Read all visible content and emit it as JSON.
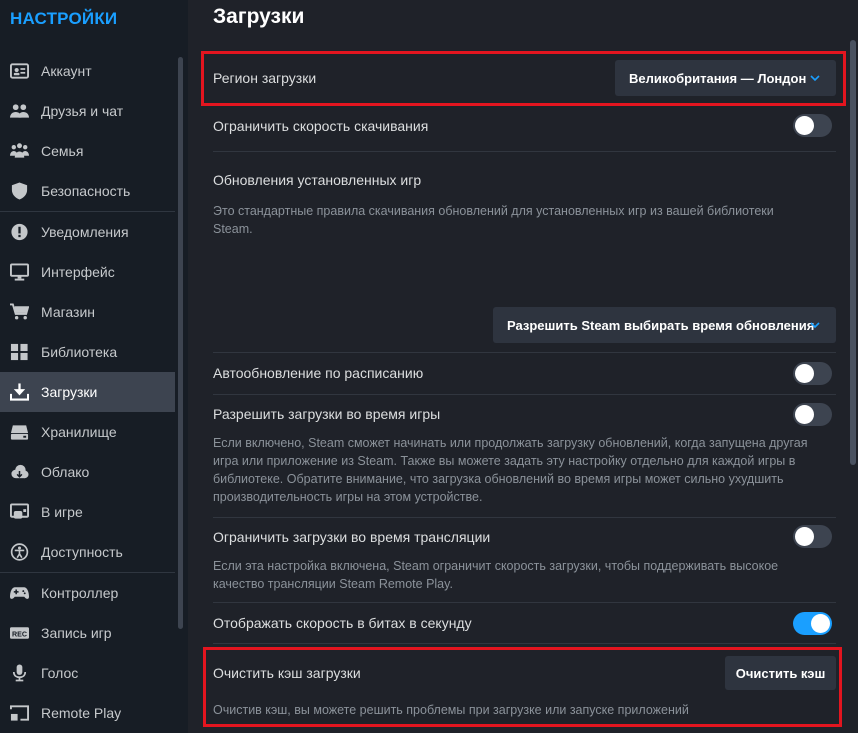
{
  "sidebar": {
    "title": "НАСТРОЙКИ",
    "items": [
      {
        "label": "Аккаунт",
        "icon": "id-card-icon"
      },
      {
        "label": "Друзья и чат",
        "icon": "friends-icon"
      },
      {
        "label": "Семья",
        "icon": "family-icon"
      },
      {
        "label": "Безопасность",
        "icon": "shield-icon"
      },
      {
        "label": "Уведомления",
        "icon": "alert-icon"
      },
      {
        "label": "Интерфейс",
        "icon": "monitor-icon"
      },
      {
        "label": "Магазин",
        "icon": "cart-icon"
      },
      {
        "label": "Библиотека",
        "icon": "grid-icon"
      },
      {
        "label": "Загрузки",
        "icon": "download-icon"
      },
      {
        "label": "Хранилище",
        "icon": "drive-icon"
      },
      {
        "label": "Облако",
        "icon": "cloud-icon"
      },
      {
        "label": "В игре",
        "icon": "ingame-icon"
      },
      {
        "label": "Доступность",
        "icon": "accessibility-icon"
      },
      {
        "label": "Контроллер",
        "icon": "gamepad-icon"
      },
      {
        "label": "Запись игр",
        "icon": "rec-icon"
      },
      {
        "label": "Голос",
        "icon": "microphone-icon"
      },
      {
        "label": "Remote Play",
        "icon": "cast-icon"
      }
    ],
    "active": "Загрузки"
  },
  "main": {
    "title": "Загрузки",
    "region": {
      "label": "Регион загрузки",
      "value": "Великобритания — Лондон"
    },
    "limit_speed": {
      "label": "Ограничить скорость скачивания",
      "on": false
    },
    "updates": {
      "label": "Обновления установленных игр",
      "desc": "Это стандартные правила скачивания обновлений для установленных игр из вашей библиотеки Steam.",
      "value": "Разрешить Steam выбирать время обновления"
    },
    "schedule": {
      "label": "Автообновление по расписанию",
      "on": false
    },
    "during_game": {
      "label": "Разрешить загрузки во время игры",
      "on": false,
      "desc": "Если включено, Steam сможет начинать или продолжать загрузку обновлений, когда запущена другая игра или приложение из Steam. Также вы можете задать эту настройку отдельно для каждой игры в библиотеке. Обратите внимание, что загрузка обновлений во время игры может сильно ухудшить производительность игры на этом устройстве."
    },
    "during_stream": {
      "label": "Ограничить загрузки во время трансляции",
      "on": false,
      "desc": "Если эта настройка включена, Steam ограничит скорость загрузки, чтобы поддерживать высокое качество трансляции Steam Remote Play."
    },
    "bits": {
      "label": "Отображать скорость в битах в секунду",
      "on": true
    },
    "cache": {
      "label": "Очистить кэш загрузки",
      "button": "Очистить кэш",
      "desc": "Очистив кэш, вы можете решить проблемы при загрузке или запуске приложений"
    }
  },
  "colors": {
    "accent": "#1a9fff",
    "highlight": "#e3151f",
    "active_bg": "#3d4450"
  }
}
